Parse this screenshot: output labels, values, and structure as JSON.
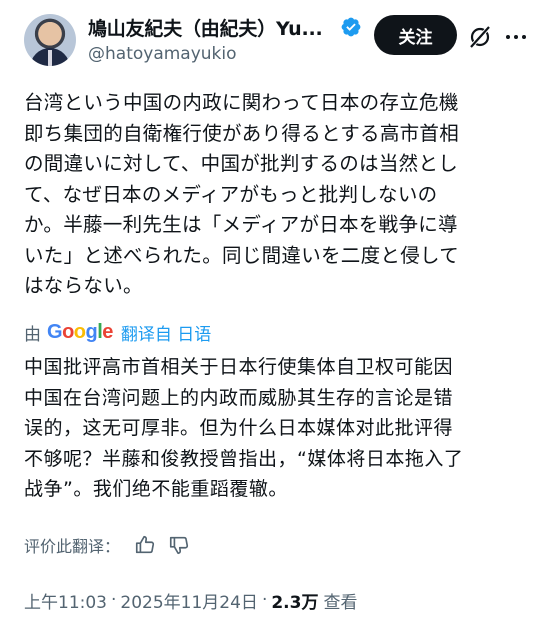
{
  "header": {
    "display_name": "鳩山友紀夫（由紀夫）Yu...",
    "handle": "@hatoyamayukio",
    "follow_label": "关注",
    "icons": [
      "verified-badge-icon",
      "grok-icon",
      "more-icon"
    ]
  },
  "tweet": {
    "lines": [
      "台湾という中国の内政に関わって日本の存立危機",
      "即ち集団的自衛権行使があり得るとする高市首相",
      "の間違いに対して、中国が批判するのは当然とし",
      "て、なぜ日本のメディアがもっと批判しないの",
      "か。半藤一利先生は「メディアが日本を戦争に導",
      "いた」と述べられた。同じ間違いを二度と侵して",
      "はならない。"
    ]
  },
  "translate": {
    "by": "由",
    "provider": "Google",
    "link": "翻译自 日语"
  },
  "translation": {
    "lines": [
      "中国批评高市首相关于日本行使集体自卫权可能因",
      "中国在台湾问题上的内政而威胁其生存的言论是错",
      "误的，这无可厚非。但为什么日本媒体对此批评得",
      "不够呢？半藤和俊教授曾指出，“媒体将日本拖入了",
      "战争”。我们绝不能重蹈覆辙。"
    ]
  },
  "rate": {
    "label": "评价此翻译："
  },
  "meta": {
    "time": "上午11:03",
    "date": "2025年11月24日",
    "views_count": "2.3万",
    "views_label": "查看"
  },
  "colors": {
    "accent": "#1d9bf0",
    "text": "#0f1419",
    "secondary": "#536471",
    "follow_bg": "#0f1419"
  }
}
